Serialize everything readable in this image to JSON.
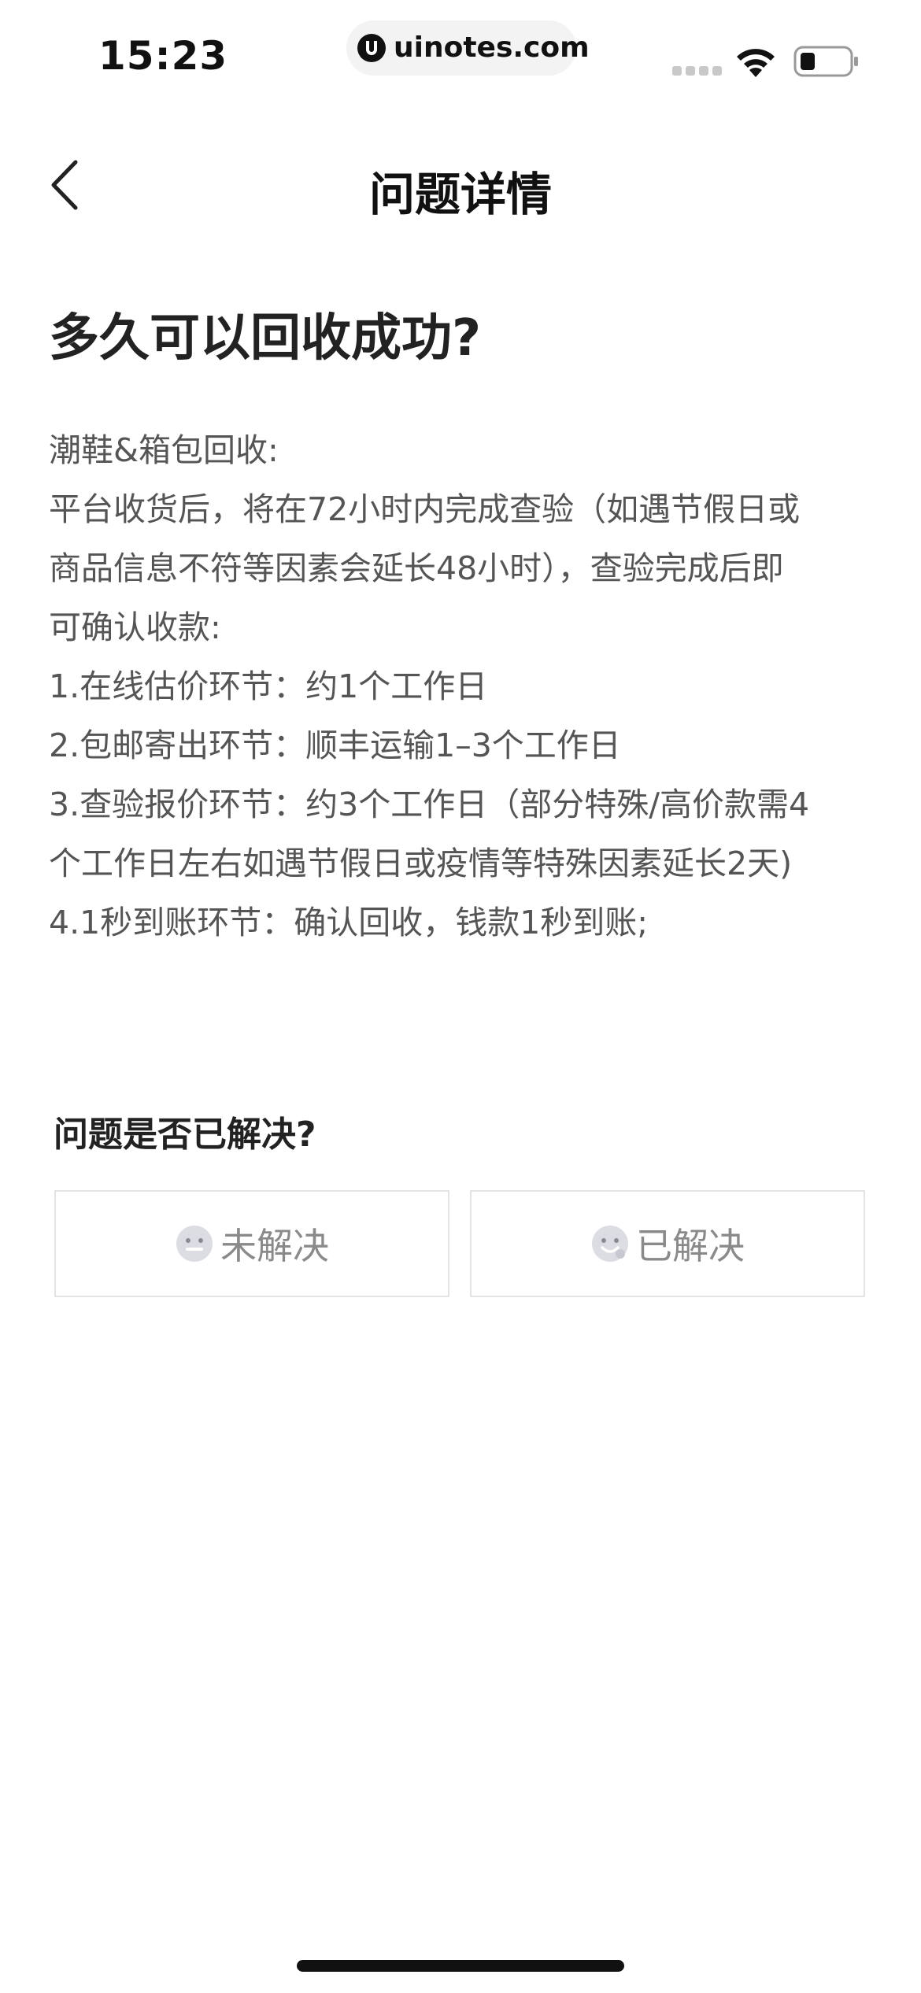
{
  "status_bar": {
    "time": "15:23",
    "url": "uinotes.com",
    "icons": [
      "signal-icon",
      "wifi-icon",
      "battery-icon"
    ]
  },
  "nav": {
    "title": "问题详情",
    "back_icon": "chevron-left-icon"
  },
  "question": {
    "title": "多久可以回收成功?"
  },
  "answer": {
    "lines": [
      "潮鞋&箱包回收:",
      "平台收货后，将在72小时内完成查验（如遇节假日或",
      "商品信息不符等因素会延长48小时），查验完成后即",
      "可确认收款:",
      "1.在线估价环节：约1个工作日",
      "2.包邮寄出环节：顺丰运输1–3个工作日",
      "3.查验报价环节：约3个工作日（部分特殊/高价款需4",
      "个工作日左右如遇节假日或疫情等特殊因素延长2天)",
      "4.1秒到账环节：确认回收，钱款1秒到账;"
    ]
  },
  "feedback": {
    "question": "问题是否已解决?",
    "unsolved_label": "未解决",
    "unsolved_icon": "neutral-face-icon",
    "solved_label": "已解决",
    "solved_icon": "smile-face-icon"
  }
}
